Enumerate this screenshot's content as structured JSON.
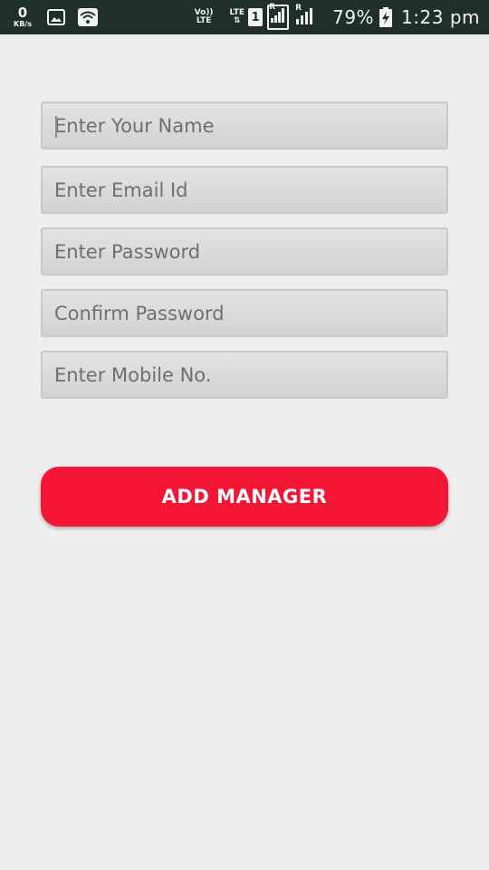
{
  "status_bar": {
    "network_speed": {
      "value": "0",
      "unit": "KB/s"
    },
    "volte": {
      "top": "Vo))",
      "bottom": "LTE"
    },
    "lte": {
      "top": "LTE",
      "bottom": "⇅"
    },
    "sim_slot": "1",
    "roaming": "R",
    "battery_percent": "79%",
    "time": "1:23 pm",
    "icons": [
      "gallery-icon",
      "wifi-icon",
      "signal-icon",
      "battery-charging-icon"
    ]
  },
  "form": {
    "fields": [
      {
        "placeholder": "Enter Your Name",
        "value": ""
      },
      {
        "placeholder": "Enter Email Id",
        "value": ""
      },
      {
        "placeholder": "Enter Password",
        "value": ""
      },
      {
        "placeholder": "Confirm Password",
        "value": ""
      },
      {
        "placeholder": "Enter Mobile No.",
        "value": ""
      }
    ]
  },
  "actions": {
    "add_manager_label": "ADD MANAGER"
  },
  "colors": {
    "status_bar_bg": "#1f2f2c",
    "page_bg": "#eeeeee",
    "button_bg": "#f51535",
    "button_text": "#ffffff"
  }
}
